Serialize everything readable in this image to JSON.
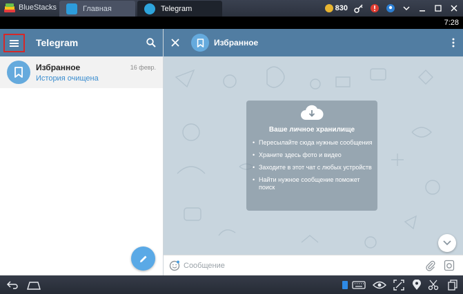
{
  "emulator": {
    "brand": "BlueStacks",
    "tabs": [
      {
        "label": "Главная",
        "icon": "home-icon"
      },
      {
        "label": "Telegram",
        "icon": "telegram-icon"
      }
    ],
    "coins": "830"
  },
  "status_bar": {
    "time": "7:28"
  },
  "sidebar": {
    "title": "Telegram",
    "chats": [
      {
        "name": "Избранное",
        "date": "16 февр.",
        "subtitle": "История очищена",
        "icon": "bookmark-icon"
      }
    ]
  },
  "chat": {
    "title": "Избранное",
    "info": {
      "title": "Ваше личное хранилище",
      "items": [
        "Пересылайте сюда нужные сообщения",
        "Храните здесь фото и видео",
        "Заходите в этот чат с любых устройств",
        "Найти нужное сообщение поможет поиск"
      ]
    },
    "composer": {
      "placeholder": "Сообщение",
      "value": ""
    }
  },
  "colors": {
    "header": "#517da2",
    "accent": "#65aadd",
    "link": "#3a8dcf",
    "highlight": "#d62828"
  }
}
